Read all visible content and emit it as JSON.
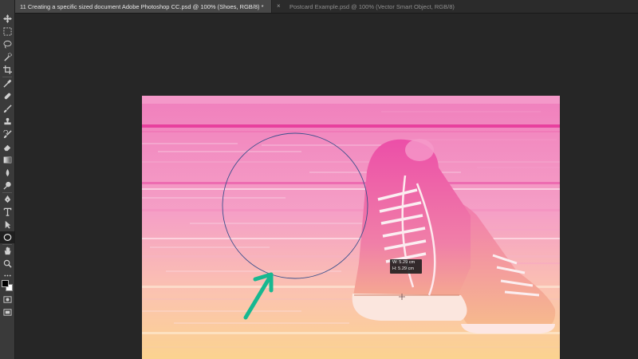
{
  "tabs": [
    {
      "label": "11 Creating a specific sized document Adobe Photoshop CC.psd @ 100% (Shoes, RGB/8) *",
      "active": true
    },
    {
      "close": "×",
      "label": "Postcard Example.psd @ 100% (Vector Smart Object, RGB/8)",
      "active": false
    }
  ],
  "tools": [
    "move-tool-icon",
    "marquee-tool-icon",
    "lasso-tool-icon",
    "quick-selection-tool-icon",
    "crop-tool-icon",
    "eyedropper-tool-icon",
    "healing-brush-tool-icon",
    "brush-tool-icon",
    "clone-stamp-tool-icon",
    "history-brush-tool-icon",
    "eraser-tool-icon",
    "gradient-tool-icon",
    "blur-tool-icon",
    "dodge-tool-icon",
    "pen-tool-icon",
    "type-tool-icon",
    "path-selection-tool-icon",
    "ellipse-tool-icon",
    "hand-tool-icon",
    "zoom-tool-icon",
    "more-tools-icon",
    "color-swatches-icon",
    "quick-mask-icon",
    "screen-mode-icon"
  ],
  "selected_tool": "ellipse-tool-icon",
  "dimension_tooltip": {
    "width": "W: 5.29 cm",
    "height": "H: 5.29 cm"
  },
  "colors": {
    "annotation_arrow": "#17b890",
    "ellipse_path": "#3a4f8c",
    "foreground_swatch": "#000000",
    "background_swatch": "#ffffff"
  }
}
